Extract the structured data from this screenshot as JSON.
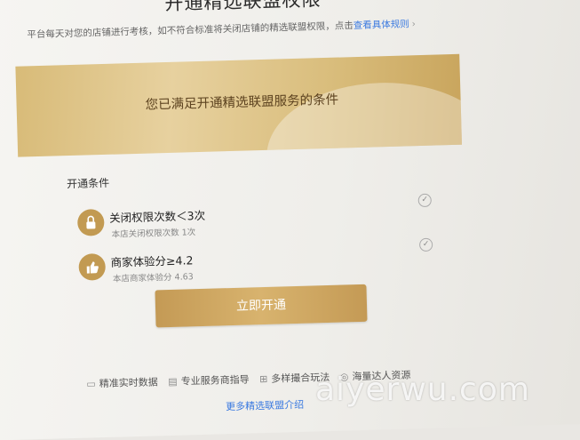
{
  "page": {
    "title": "开通精选联盟权限",
    "subtitle": "平台每天对您的店铺进行考核，如不符合标准将关闭店铺的精选联盟权限，点击",
    "rules_link": "查看具体规则",
    "rules_chevron": "›"
  },
  "banner": {
    "text": "您已满足开通精选联盟服务的条件"
  },
  "conditions": {
    "heading": "开通条件",
    "items": [
      {
        "icon": "lock-icon",
        "label": "关闭权限次数＜3次",
        "detail": "本店关闭权限次数 1次",
        "met": true
      },
      {
        "icon": "thumbs-up-icon",
        "label": "商家体验分≥4.2",
        "detail": "本店商家体验分 4.63",
        "met": true
      }
    ]
  },
  "action": {
    "open_button": "立即开通"
  },
  "features": [
    {
      "icon": "monitor-icon",
      "label": "精准实时数据"
    },
    {
      "icon": "grid-icon",
      "label": "专业服务商指导"
    },
    {
      "icon": "apps-icon",
      "label": "多样撮合玩法"
    },
    {
      "icon": "user-icon",
      "label": "海量达人资源"
    }
  ],
  "more_link": "更多精选联盟介绍",
  "watermark": "aiyerwu.com",
  "colors": {
    "gold": "#c49a55",
    "link": "#3b7ae0"
  }
}
